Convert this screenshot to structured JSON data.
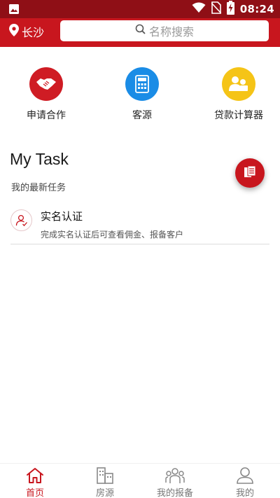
{
  "statusbar": {
    "time": "08:24",
    "icons": [
      "image-icon",
      "wifi-icon",
      "no-sim-icon",
      "battery-charging-icon"
    ]
  },
  "header": {
    "city": "长沙",
    "search_placeholder": "名称搜索"
  },
  "quick_entries": [
    {
      "label": "申请合作",
      "icon": "handshake-icon",
      "color": "#cf1c24"
    },
    {
      "label": "客源",
      "icon": "calculator-icon",
      "color": "#1a8ce6"
    },
    {
      "label": "贷款计算器",
      "icon": "people-icon",
      "color": "#f5c417"
    }
  ],
  "task": {
    "title": "My Task",
    "subtitle": "我的最新任务",
    "items": [
      {
        "name": "实名认证",
        "desc": "完成实名认证后可查看佣金、报备客户"
      }
    ]
  },
  "bottom_nav": [
    {
      "label": "首页",
      "icon": "home-icon",
      "active": true
    },
    {
      "label": "房源",
      "icon": "building-icon",
      "active": false
    },
    {
      "label": "我的报备",
      "icon": "group-icon",
      "active": false
    },
    {
      "label": "我的",
      "icon": "user-icon",
      "active": false
    }
  ],
  "colors": {
    "brand_red": "#c8161e",
    "statusbar": "#8f0f16",
    "blue": "#1a8ce6",
    "yellow": "#f5c417"
  }
}
